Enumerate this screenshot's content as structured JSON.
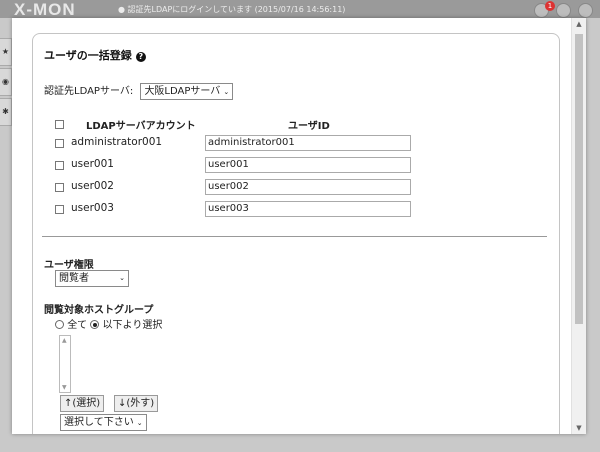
{
  "app": {
    "logo": "X-MON",
    "status_text": "● 認証先LDAPにログインしています (2015/07/16 14:56:11)",
    "notification_count": "1",
    "side_tabs": [
      "★",
      "◉",
      "✱"
    ]
  },
  "dialog": {
    "title": "ユーザの一括登録",
    "help_glyph": "?",
    "ldap_label": "認証先LDAPサーバ:",
    "ldap_value": "大阪LDAPサーバ",
    "table": {
      "col_account": "LDAPサーバアカウント",
      "col_userid": "ユーザID",
      "rows": [
        {
          "account": "administrator001",
          "userid": "administrator001"
        },
        {
          "account": "user001",
          "userid": "user001"
        },
        {
          "account": "user002",
          "userid": "user002"
        },
        {
          "account": "user003",
          "userid": "user003"
        }
      ]
    },
    "permission_label": "ユーザ権限",
    "permission_value": "閲覧者",
    "hostgroup_label": "閲覧対象ホストグループ",
    "radio_all": "全て",
    "radio_select": "以下より選択",
    "add_button": "↑(選択)",
    "remove_button": "↓(外す)",
    "choose_placeholder": "選択して下さい"
  }
}
